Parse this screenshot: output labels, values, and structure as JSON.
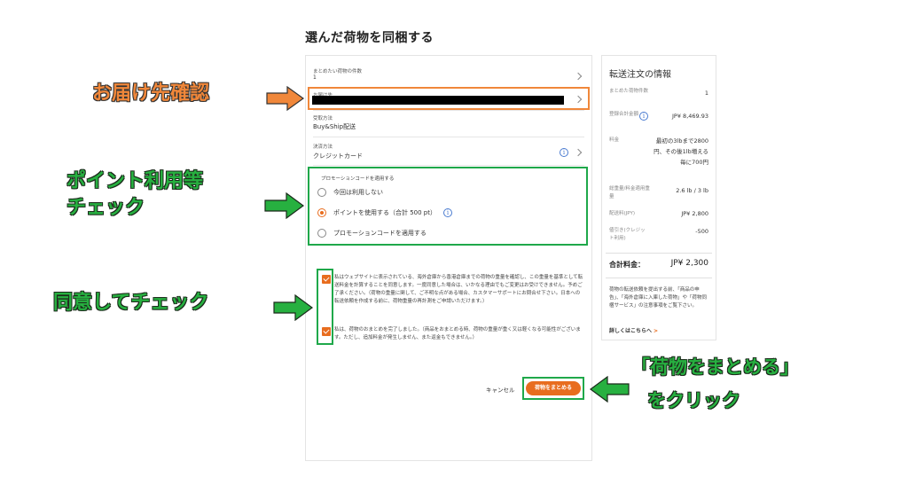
{
  "page": {
    "title": "選んだ荷物を同梱する"
  },
  "form": {
    "package_count": {
      "label": "まとめたい荷物の件数",
      "value": "1"
    },
    "address": {
      "label": "お届け先"
    },
    "shipping_method": {
      "label": "受取方法",
      "value": "Buy&Ship配送"
    },
    "payment_method": {
      "label": "決済方法",
      "value": "クレジットカード"
    },
    "promotion": {
      "title": "プロモーションコードを適用する",
      "options": [
        {
          "label": "今回は利用しない",
          "selected": false
        },
        {
          "label": "ポイントを使用する（合計 500 pt）",
          "selected": true
        },
        {
          "label": "プロモーションコードを適用する",
          "selected": false
        }
      ]
    },
    "consents": [
      {
        "text": "私はウェブサイトに表示されている、海外倉庫から香港倉庫までの荷物の重量を確認し、この重量を基準として転送料金を計算することを同意します。一度同意した場合は、いかなる理由でもご変更はお受けできません。予めご了承ください。（荷物の重量に関して、ご不明な点がある場合、カスタマーサポートにお問合せ下さい。日本への転送依頼を作成する前に、荷物重量の再計測をご申請いただけます。）",
        "checked": true
      },
      {
        "text": "私は、荷物のおまとめを完了しました。（商品をおまとめる時、荷物の重量が重く又は軽くなる可能性がございます。ただし、追加料金が発生しません、また返金もできません。）",
        "checked": true
      }
    ],
    "cancel_label": "キャンセル",
    "submit_label": "荷物をまとめる"
  },
  "summary": {
    "title": "転送注文の情報",
    "rows": [
      {
        "label": "まとめた荷物件数",
        "value": "1"
      },
      {
        "label": "登録合計金額",
        "value": "JP¥ 8,469.93"
      },
      {
        "label": "料金",
        "value": "最初の3lbまで2800円、その後1lb増える毎に700円"
      },
      {
        "label": "総重量/料金適用重量",
        "value": "2.6 lb / 3 lb"
      },
      {
        "label": "配送料(JPY)",
        "value": "JP¥ 2,800"
      },
      {
        "label": "値引き(クレジット利用)",
        "value": "-500"
      }
    ],
    "total_label": "合計料金：",
    "total_value": "JP¥ 2,300",
    "notice": "荷物の転送依頼を提出する前、「商品の申告」、「海外倉庫に入庫した荷物」や「荷物同梱サービス」の注意事項をご覧下さい。",
    "more_link": "詳しくはこちらへ"
  },
  "annotations": {
    "address_check": "お届け先確認",
    "points_check_line1": "ポイント利用等",
    "points_check_line2": "チェック",
    "agree_check": "同意してチェック",
    "click_line1": "「荷物をまとめる」",
    "click_line2": "をクリック"
  },
  "colors": {
    "accent": "#e86d1f",
    "annotation_orange": "#f0873a",
    "annotation_green": "#27b040"
  }
}
